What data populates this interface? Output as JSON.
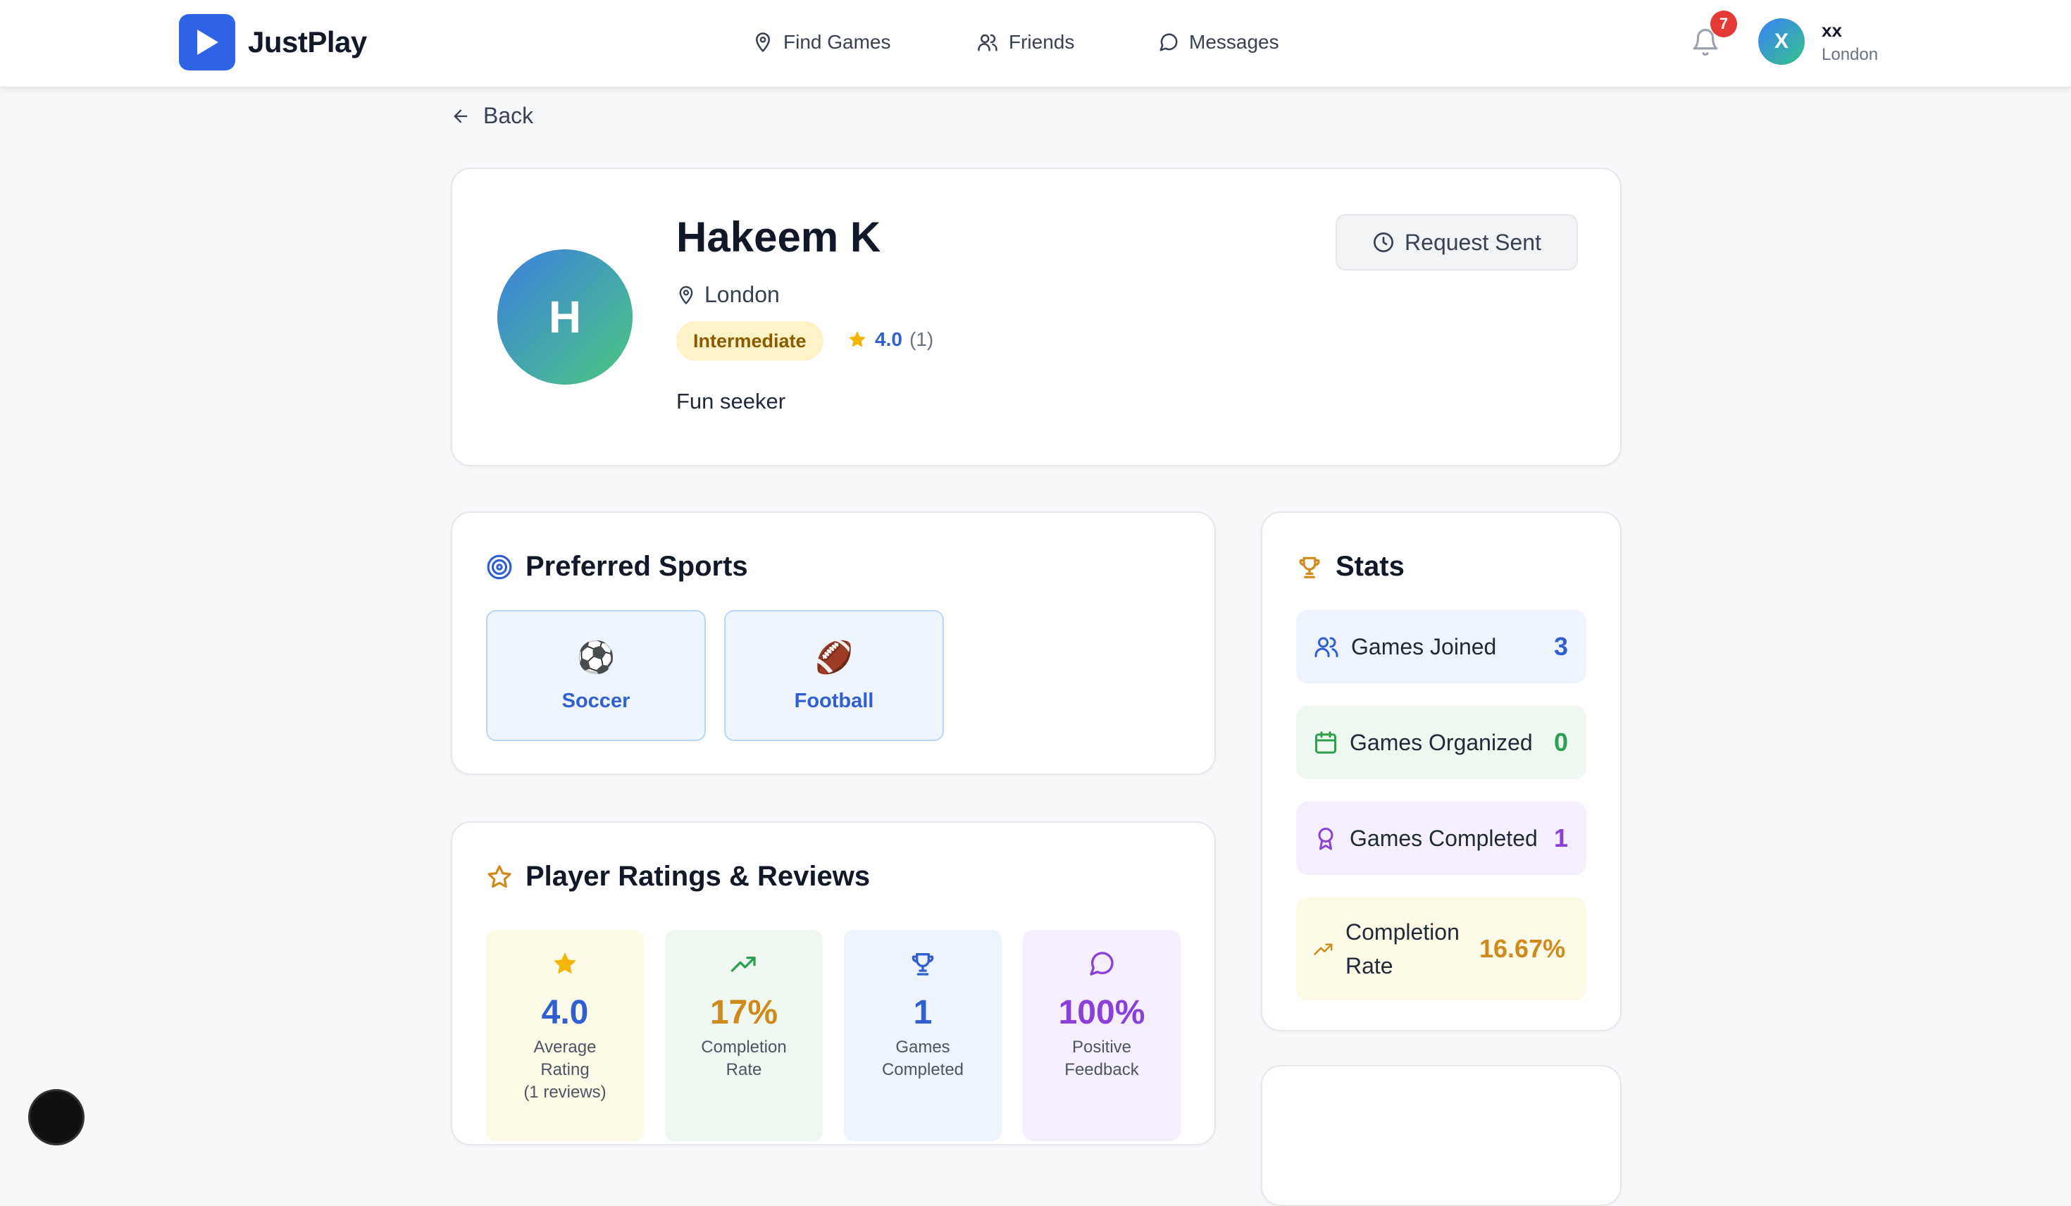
{
  "brand": {
    "name": "JustPlay",
    "color": "#2f63e6"
  },
  "nav": {
    "find_games": "Find Games",
    "friends": "Friends",
    "messages": "Messages"
  },
  "notifications": {
    "count": "7"
  },
  "user": {
    "initial": "X",
    "name": "xx",
    "location": "London"
  },
  "back_label": "Back",
  "profile": {
    "initial": "H",
    "name": "Hakeem K",
    "location": "London",
    "level": "Intermediate",
    "rating": "4.0",
    "rating_count": "(1)",
    "bio": "Fun seeker",
    "request_button": "Request Sent"
  },
  "preferred_sports": {
    "title": "Preferred Sports",
    "items": [
      {
        "emoji": "⚽",
        "label": "Soccer"
      },
      {
        "emoji": "🏈",
        "label": "Football"
      }
    ]
  },
  "stats": {
    "title": "Stats",
    "games_joined": {
      "label": "Games Joined",
      "value": "3",
      "color": "#2f5fd0"
    },
    "games_organized": {
      "label": "Games Organized",
      "value": "0",
      "color": "#2e9e4f"
    },
    "games_completed": {
      "label": "Games Completed",
      "value": "1",
      "color": "#8b3fd9"
    },
    "completion_rate": {
      "label": "Completion Rate",
      "value": "16.67%",
      "color": "#d08a1c"
    }
  },
  "ratings": {
    "title": "Player Ratings & Reviews",
    "tiles": [
      {
        "value": "4.0",
        "label_1": "Average",
        "label_2": "Rating",
        "label_3": "(1 reviews)",
        "color": "#2f5fd0"
      },
      {
        "value": "17%",
        "label_1": "Completion",
        "label_2": "Rate",
        "color": "#d08a1c"
      },
      {
        "value": "1",
        "label_1": "Games",
        "label_2": "Completed",
        "color": "#2f5fd0"
      },
      {
        "value": "100%",
        "label_1": "Positive",
        "label_2": "Feedback",
        "color": "#8b3fd9"
      }
    ]
  }
}
